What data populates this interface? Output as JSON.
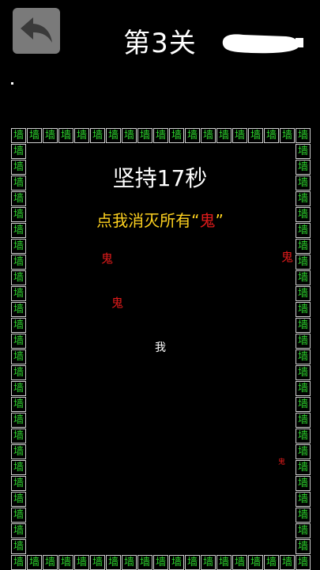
{
  "header": {
    "back_icon": "back-arrow-icon",
    "level_title": "第3关"
  },
  "wall": {
    "brick_label": "墙",
    "brick_color": "#2cd12c",
    "border_color": "#cfcfcf"
  },
  "game": {
    "timer_text": "坚持17秒",
    "hint_prefix": "点我消灭所有",
    "hint_open_quote": "“",
    "hint_target": "鬼",
    "hint_close_quote": "”",
    "hint_color": "#ffd21f",
    "ghost_label": "鬼",
    "ghost_color": "#e01b1b",
    "player_label": "我"
  }
}
